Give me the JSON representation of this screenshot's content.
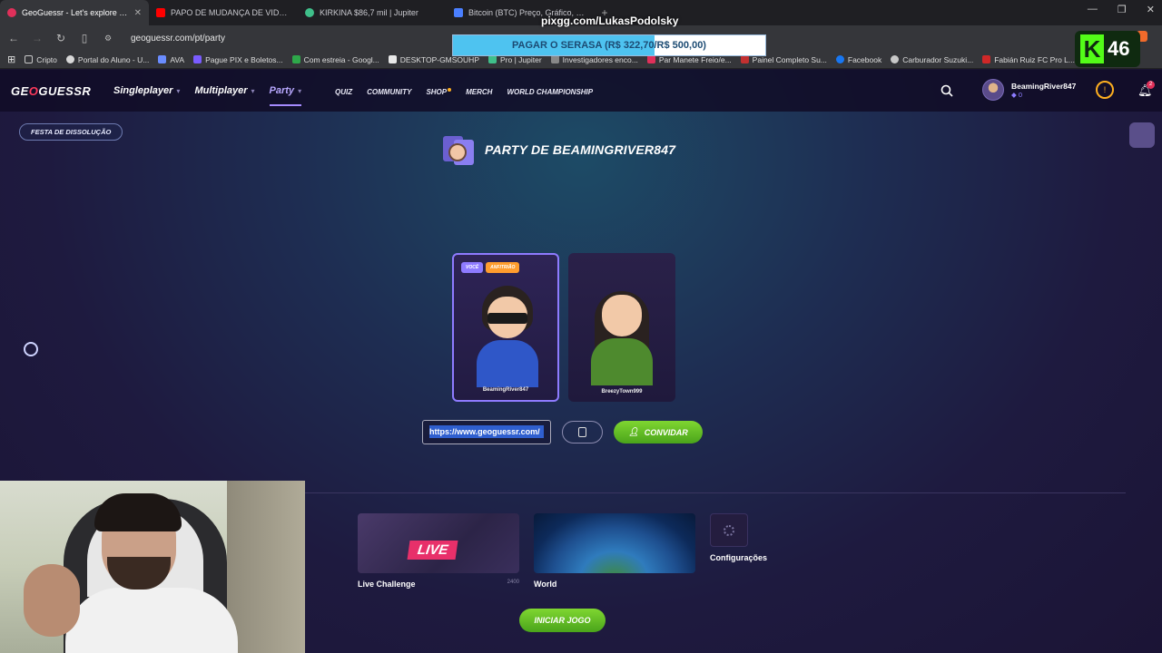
{
  "browser": {
    "tabs": [
      {
        "title": "GeoGuessr - Let's explore the w",
        "color": "#e0305a",
        "active": true
      },
      {
        "title": "PAPO DE MUDANÇA DE VIDA COM",
        "color": "#ff0000",
        "active": false
      },
      {
        "title": "KIRKINA $86,7 mil | Jupiter",
        "color": "#3fbf8a",
        "active": false
      },
      {
        "title": "Bitcoin (BTC) Preço, Gráfico, Capitali",
        "color": "#4a7fff",
        "active": false
      }
    ],
    "new_tab": "+",
    "url": "geoguessr.com/pt/party",
    "bookmarks": [
      {
        "label": "Cripto",
        "color": "#c8c8c8"
      },
      {
        "label": "Portal do Aluno - U...",
        "color": "#d8d8d8"
      },
      {
        "label": "AVA",
        "color": "#6a8cff"
      },
      {
        "label": "Pague PIX e Boletos...",
        "color": "#7a5cff"
      },
      {
        "label": "Com estreia - Googl...",
        "color": "#2ea84a"
      },
      {
        "label": "DESKTOP-GMSOUHP",
        "color": "#e8e8e8"
      },
      {
        "label": "Pro | Jupiter",
        "color": "#3fbf8a"
      },
      {
        "label": "Investigadores enco...",
        "color": "#888888"
      },
      {
        "label": "Par Manete Freio/e...",
        "color": "#e0305a"
      },
      {
        "label": "Painel Completo Su...",
        "color": "#c23030"
      },
      {
        "label": "Facebook",
        "color": "#1877f2"
      },
      {
        "label": "Carburador Suzuki...",
        "color": "#c8c8c8"
      },
      {
        "label": "Fabián Ruiz FC Pro L...",
        "color": "#d02828"
      }
    ]
  },
  "overlay": {
    "stream_url": "pixgg.com/LukasPodolsky",
    "goal_text": "PAGAR O SERASA (R$ 322,70/R$ 500,00)",
    "goal_progress": 0.645,
    "kick_letter": "K",
    "viewer_count": "46"
  },
  "app": {
    "logo_left": "GE",
    "logo_o": "O",
    "logo_right": "GUESSR",
    "nav": [
      {
        "label": "Singleplayer",
        "selected": false
      },
      {
        "label": "Multiplayer",
        "selected": false
      },
      {
        "label": "Party",
        "selected": true
      }
    ],
    "subnav": [
      "QUIZ",
      "COMMUNITY",
      "SHOP",
      "MERCH",
      "WORLD CHAMPIONSHIP"
    ],
    "user": {
      "name": "BeamingRiver847",
      "level": "0"
    },
    "coin_label": "!",
    "notifications": "2"
  },
  "party": {
    "leave_label": "FESTA DE DISSOLUÇÃO",
    "title": "PARTY DE BEAMINGRIVER847",
    "players": [
      {
        "name": "BeamingRiver847",
        "badges": [
          "VOCÊ",
          "ANFITRIÃO"
        ],
        "body_color": "#2f57c8",
        "glasses": true
      },
      {
        "name": "BreezyTown999",
        "badges": [],
        "body_color": "#4e8a2e",
        "glasses": false
      }
    ],
    "invite_link": "https://www.geoguessr.com/",
    "invite_label": "CONVIDAR",
    "modes": [
      {
        "name": "Live Challenge",
        "meta": "2400",
        "tag": "LIVE"
      },
      {
        "name": "World",
        "meta": ""
      },
      {
        "name": "Configurações",
        "meta": ""
      }
    ],
    "start_label": "INICIAR JOGO"
  }
}
